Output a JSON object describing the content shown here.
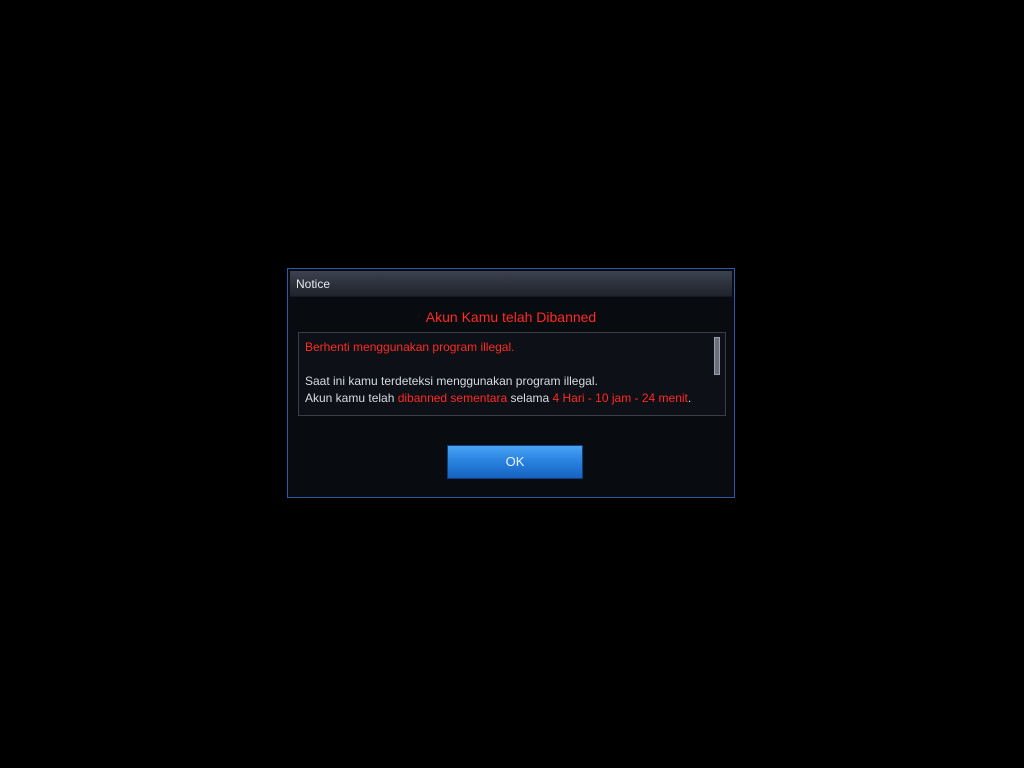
{
  "dialog": {
    "title": "Notice",
    "heading": "Akun Kamu telah Dibanned",
    "message": {
      "line1": "Berhenti menggunakan program illegal.",
      "line2": "Saat ini kamu terdeteksi menggunakan program illegal.",
      "line3_prefix": "Akun kamu telah ",
      "line3_status": "dibanned sementara",
      "line3_middle": " selama ",
      "line3_duration": "4 Hari - 10 jam - 24 menit",
      "line3_suffix": "."
    },
    "ok_label": "OK"
  },
  "colors": {
    "background": "#000000",
    "accent_red": "#ff2a22",
    "border_blue": "#2f58a8",
    "button_blue": "#2a83e0",
    "text_light": "#d7dbe2"
  }
}
